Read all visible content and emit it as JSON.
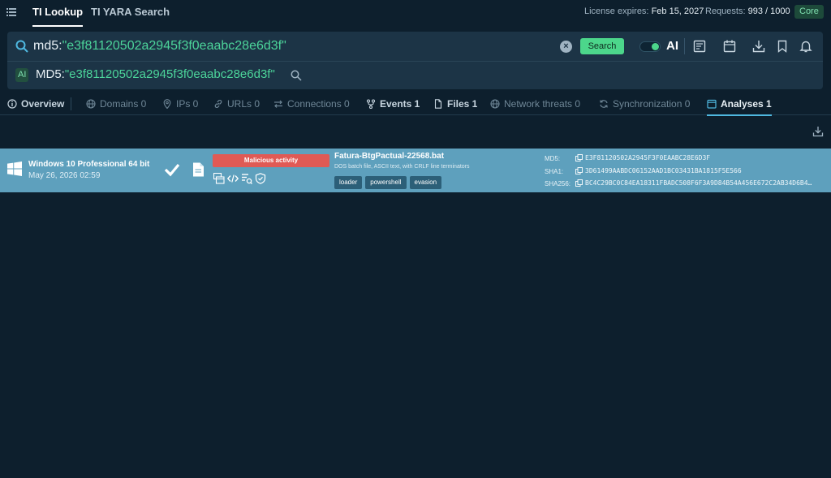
{
  "header": {
    "tabs": [
      {
        "label": "TI Lookup",
        "active": true
      },
      {
        "label": "TI YARA Search",
        "active": false
      }
    ],
    "license_label": "License expires:",
    "license_date": "Feb 15, 2027",
    "requests_label": "Requests:",
    "requests_value": "993 / 1000",
    "plan_badge": "Core"
  },
  "search": {
    "query_prefix": "md5:",
    "query_value": "\"e3f81120502a2945f3f0eaabc28e6d3f\"",
    "search_button": "Search",
    "ai_label": "AI",
    "ai_enabled": true,
    "ai_badge": "AI",
    "ai_query_prefix": "MD5:",
    "ai_query_value": "\"e3f81120502a2945f3f0eaabc28e6d3f\""
  },
  "category_tabs": [
    {
      "label": "Overview",
      "icon": "info-icon"
    },
    {
      "label": "Domains 0",
      "icon": "globe-icon"
    },
    {
      "label": "IPs 0",
      "icon": "location-icon"
    },
    {
      "label": "URLs 0",
      "icon": "link-icon"
    },
    {
      "label": "Connections 0",
      "icon": "arrows-icon"
    },
    {
      "label": "Events 1",
      "icon": "fork-icon"
    },
    {
      "label": "Files 1",
      "icon": "file-icon"
    },
    {
      "label": "Network threats 0",
      "icon": "network-icon"
    },
    {
      "label": "Synchronization 0",
      "icon": "sync-icon"
    },
    {
      "label": "Analyses 1",
      "icon": "calendar-icon"
    }
  ],
  "result": {
    "os_name": "Windows 10 Professional 64 bit",
    "date": "May 26, 2026 02:59",
    "verdict": "Malicious activity",
    "verdict_color": "#e05a55",
    "file_name": "Fatura-BtgPactual-22568.bat",
    "file_description": "DOS batch file, ASCII text, with CRLF line terminators",
    "tags": [
      "loader",
      "powershell",
      "evasion"
    ],
    "hashes": [
      {
        "label": "MD5:",
        "value": "E3F81120502A2945F3F0EAABC28E6D3F"
      },
      {
        "label": "SHA1:",
        "value": "3D61499AABDC06152AAD1BC03431BA1815F5E566"
      },
      {
        "label": "SHA256:",
        "value": "BC4C29BC0C84EA18311FBADC508F6F3A9D84B54A456E672C2AB34D6B4…"
      }
    ]
  },
  "colors": {
    "background": "#0d1f2d",
    "accent_green": "#4cd68b",
    "row_highlight": "#5ea0bd"
  }
}
